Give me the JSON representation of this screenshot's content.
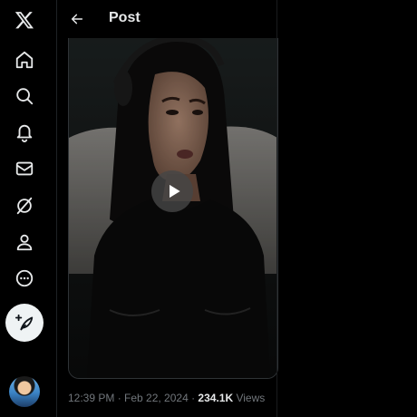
{
  "header": {
    "title": "Post",
    "back_icon": "arrow-left-icon"
  },
  "sidebar": {
    "items": [
      {
        "name": "x-logo",
        "icon": "x-logo-icon"
      },
      {
        "name": "home",
        "icon": "home-icon"
      },
      {
        "name": "explore",
        "icon": "search-icon"
      },
      {
        "name": "notifications",
        "icon": "bell-icon"
      },
      {
        "name": "messages",
        "icon": "envelope-icon"
      },
      {
        "name": "grok",
        "icon": "grok-icon"
      },
      {
        "name": "profile",
        "icon": "person-icon"
      },
      {
        "name": "more",
        "icon": "more-circle-icon"
      }
    ],
    "compose_icon": "feather-plus-icon",
    "avatar": "account-avatar"
  },
  "post": {
    "timestamp": "12:39 PM · Feb 22, 2024 · ",
    "views_count": "234.1K",
    "views_label": " Views",
    "video_control_icon": "play-icon"
  },
  "colors": {
    "background": "#000000",
    "text_primary": "#e7e9ea",
    "text_secondary": "#71767b",
    "compose_bg": "#eff3f4"
  }
}
